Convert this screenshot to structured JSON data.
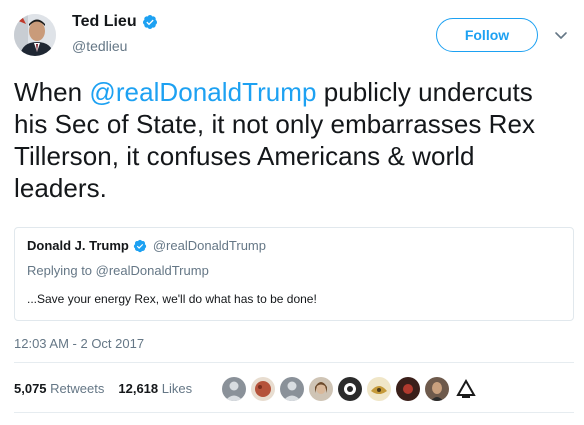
{
  "author": {
    "name": "Ted Lieu",
    "handle": "@tedlieu",
    "verified": true
  },
  "follow_button": {
    "label": "Follow"
  },
  "menu": {
    "icon": "chevron-down-icon"
  },
  "tweet": {
    "segments": [
      {
        "text": "When ",
        "type": "text"
      },
      {
        "text": "@realDonaldTrump",
        "type": "mention"
      },
      {
        "text": " publicly undercuts his Sec of State, it not only embarrasses Rex Tillerson, it confuses Americans & world leaders.",
        "type": "text"
      }
    ]
  },
  "quoted_tweet": {
    "name": "Donald J. Trump",
    "handle": "@realDonaldTrump",
    "verified": true,
    "replying_to": "Replying to @realDonaldTrump",
    "text": "...Save your energy Rex, we'll do what has to be done!"
  },
  "timestamp": "12:03 AM - 2 Oct 2017",
  "stats": {
    "retweets_count": "5,075",
    "retweets_label": "Retweets",
    "likes_count": "12,618",
    "likes_label": "Likes"
  },
  "likers": [
    {
      "name": "liker-avatar-1",
      "color": "#8a9199"
    },
    {
      "name": "liker-avatar-2",
      "color": "#b5533b"
    },
    {
      "name": "liker-avatar-3",
      "color": "#8a9199"
    },
    {
      "name": "liker-avatar-4",
      "color": "#a08262"
    },
    {
      "name": "liker-avatar-5",
      "color": "#2b2b2b"
    },
    {
      "name": "liker-avatar-6",
      "color": "#c59a3a"
    },
    {
      "name": "liker-avatar-7",
      "color": "#3a1f1a"
    },
    {
      "name": "liker-avatar-8",
      "color": "#6e5a4c"
    },
    {
      "name": "liker-avatar-9",
      "color": "#ffffff"
    }
  ],
  "colors": {
    "link": "#1da1f2",
    "text": "#14171a",
    "muted": "#657786",
    "border": "#e1e8ed"
  }
}
